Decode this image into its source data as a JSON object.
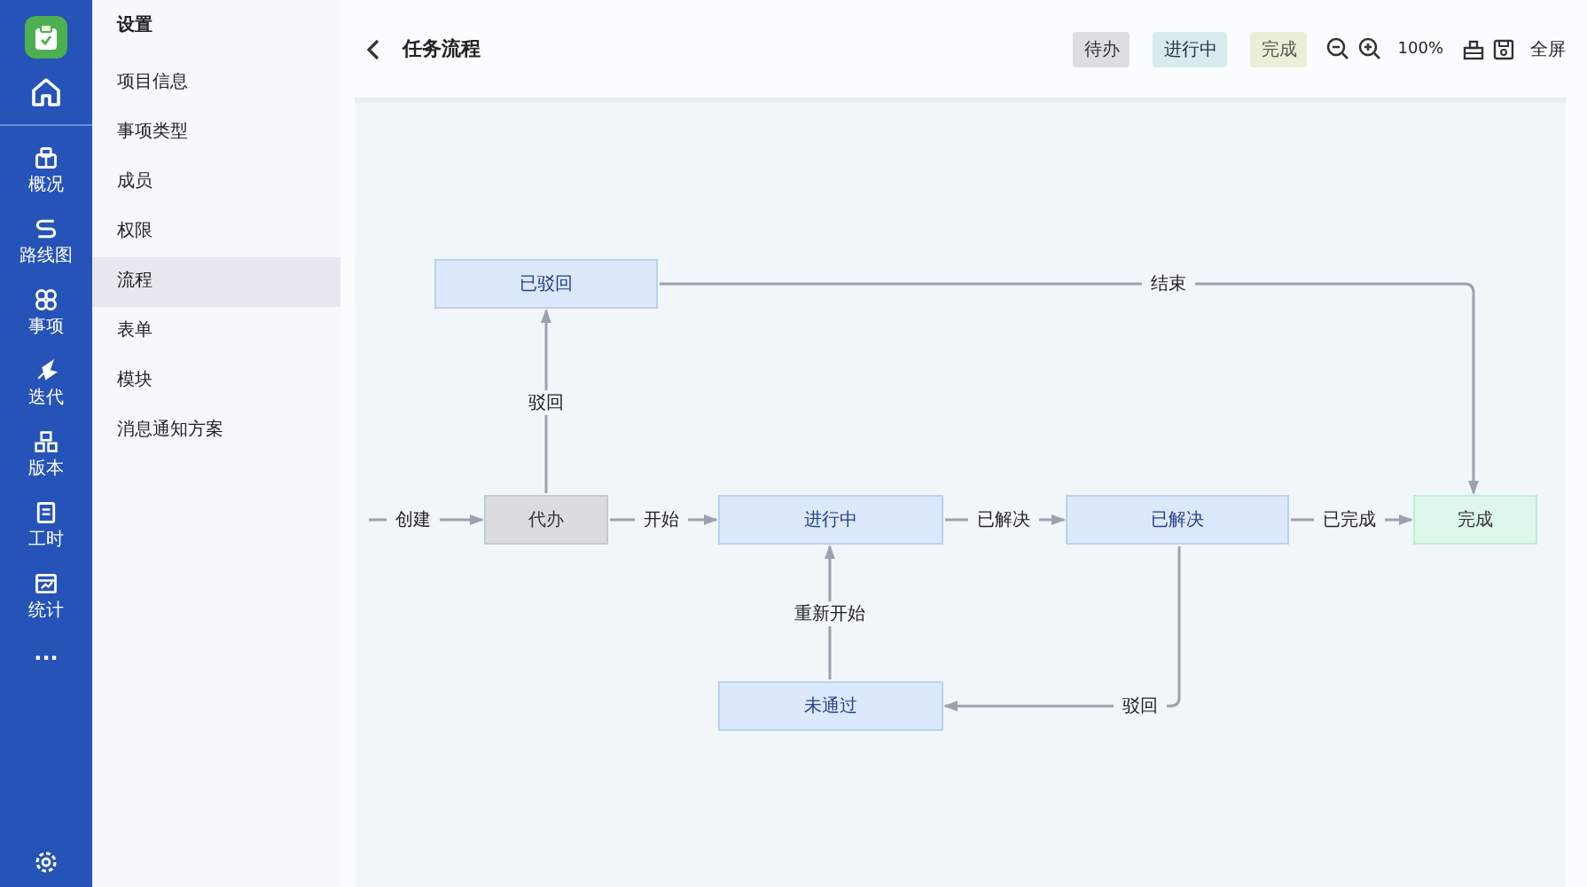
{
  "rail": {
    "items": [
      {
        "label": "概况",
        "kind": "overview"
      },
      {
        "label": "路线图",
        "kind": "roadmap"
      },
      {
        "label": "事项",
        "kind": "issues"
      },
      {
        "label": "迭代",
        "kind": "iteration"
      },
      {
        "label": "版本",
        "kind": "version"
      },
      {
        "label": "工时",
        "kind": "worklog"
      },
      {
        "label": "统计",
        "kind": "stats"
      }
    ],
    "more": "···"
  },
  "settings_menu": {
    "title": "设置",
    "items": [
      {
        "label": "项目信息",
        "selected": false
      },
      {
        "label": "事项类型",
        "selected": false
      },
      {
        "label": "成员",
        "selected": false
      },
      {
        "label": "权限",
        "selected": false
      },
      {
        "label": "流程",
        "selected": true
      },
      {
        "label": "表单",
        "selected": false
      },
      {
        "label": "模块",
        "selected": false
      },
      {
        "label": "消息通知方案",
        "selected": false
      }
    ]
  },
  "header": {
    "title": "任务流程",
    "legend": [
      {
        "label": "待办",
        "kind": "todo"
      },
      {
        "label": "进行中",
        "kind": "doing"
      },
      {
        "label": "完成",
        "kind": "done"
      }
    ],
    "zoom": "100%",
    "fullscreen": "全屏"
  },
  "flow": {
    "nodes": [
      {
        "label": "已驳回",
        "kind": "doing"
      },
      {
        "label": "代办",
        "kind": "todo"
      },
      {
        "label": "进行中",
        "kind": "doing"
      },
      {
        "label": "已解决",
        "kind": "doing"
      },
      {
        "label": "完成",
        "kind": "done"
      },
      {
        "label": "未通过",
        "kind": "doing"
      }
    ],
    "edges": [
      {
        "label": "创建"
      },
      {
        "label": "驳回"
      },
      {
        "label": "结束"
      },
      {
        "label": "开始"
      },
      {
        "label": "已解决"
      },
      {
        "label": "已完成"
      },
      {
        "label": "驳回"
      },
      {
        "label": "重新开始"
      }
    ]
  }
}
